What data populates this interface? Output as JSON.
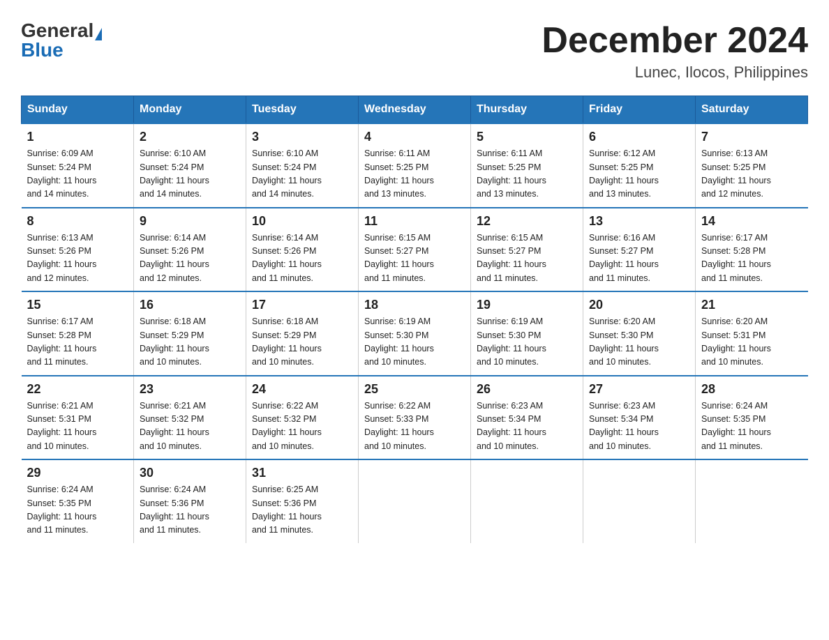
{
  "header": {
    "logo_general": "General",
    "logo_blue": "Blue",
    "month_title": "December 2024",
    "location": "Lunec, Ilocos, Philippines"
  },
  "days_of_week": [
    "Sunday",
    "Monday",
    "Tuesday",
    "Wednesday",
    "Thursday",
    "Friday",
    "Saturday"
  ],
  "weeks": [
    [
      {
        "day": "1",
        "sunrise": "6:09 AM",
        "sunset": "5:24 PM",
        "daylight": "11 hours and 14 minutes."
      },
      {
        "day": "2",
        "sunrise": "6:10 AM",
        "sunset": "5:24 PM",
        "daylight": "11 hours and 14 minutes."
      },
      {
        "day": "3",
        "sunrise": "6:10 AM",
        "sunset": "5:24 PM",
        "daylight": "11 hours and 14 minutes."
      },
      {
        "day": "4",
        "sunrise": "6:11 AM",
        "sunset": "5:25 PM",
        "daylight": "11 hours and 13 minutes."
      },
      {
        "day": "5",
        "sunrise": "6:11 AM",
        "sunset": "5:25 PM",
        "daylight": "11 hours and 13 minutes."
      },
      {
        "day": "6",
        "sunrise": "6:12 AM",
        "sunset": "5:25 PM",
        "daylight": "11 hours and 13 minutes."
      },
      {
        "day": "7",
        "sunrise": "6:13 AM",
        "sunset": "5:25 PM",
        "daylight": "11 hours and 12 minutes."
      }
    ],
    [
      {
        "day": "8",
        "sunrise": "6:13 AM",
        "sunset": "5:26 PM",
        "daylight": "11 hours and 12 minutes."
      },
      {
        "day": "9",
        "sunrise": "6:14 AM",
        "sunset": "5:26 PM",
        "daylight": "11 hours and 12 minutes."
      },
      {
        "day": "10",
        "sunrise": "6:14 AM",
        "sunset": "5:26 PM",
        "daylight": "11 hours and 11 minutes."
      },
      {
        "day": "11",
        "sunrise": "6:15 AM",
        "sunset": "5:27 PM",
        "daylight": "11 hours and 11 minutes."
      },
      {
        "day": "12",
        "sunrise": "6:15 AM",
        "sunset": "5:27 PM",
        "daylight": "11 hours and 11 minutes."
      },
      {
        "day": "13",
        "sunrise": "6:16 AM",
        "sunset": "5:27 PM",
        "daylight": "11 hours and 11 minutes."
      },
      {
        "day": "14",
        "sunrise": "6:17 AM",
        "sunset": "5:28 PM",
        "daylight": "11 hours and 11 minutes."
      }
    ],
    [
      {
        "day": "15",
        "sunrise": "6:17 AM",
        "sunset": "5:28 PM",
        "daylight": "11 hours and 11 minutes."
      },
      {
        "day": "16",
        "sunrise": "6:18 AM",
        "sunset": "5:29 PM",
        "daylight": "11 hours and 10 minutes."
      },
      {
        "day": "17",
        "sunrise": "6:18 AM",
        "sunset": "5:29 PM",
        "daylight": "11 hours and 10 minutes."
      },
      {
        "day": "18",
        "sunrise": "6:19 AM",
        "sunset": "5:30 PM",
        "daylight": "11 hours and 10 minutes."
      },
      {
        "day": "19",
        "sunrise": "6:19 AM",
        "sunset": "5:30 PM",
        "daylight": "11 hours and 10 minutes."
      },
      {
        "day": "20",
        "sunrise": "6:20 AM",
        "sunset": "5:30 PM",
        "daylight": "11 hours and 10 minutes."
      },
      {
        "day": "21",
        "sunrise": "6:20 AM",
        "sunset": "5:31 PM",
        "daylight": "11 hours and 10 minutes."
      }
    ],
    [
      {
        "day": "22",
        "sunrise": "6:21 AM",
        "sunset": "5:31 PM",
        "daylight": "11 hours and 10 minutes."
      },
      {
        "day": "23",
        "sunrise": "6:21 AM",
        "sunset": "5:32 PM",
        "daylight": "11 hours and 10 minutes."
      },
      {
        "day": "24",
        "sunrise": "6:22 AM",
        "sunset": "5:32 PM",
        "daylight": "11 hours and 10 minutes."
      },
      {
        "day": "25",
        "sunrise": "6:22 AM",
        "sunset": "5:33 PM",
        "daylight": "11 hours and 10 minutes."
      },
      {
        "day": "26",
        "sunrise": "6:23 AM",
        "sunset": "5:34 PM",
        "daylight": "11 hours and 10 minutes."
      },
      {
        "day": "27",
        "sunrise": "6:23 AM",
        "sunset": "5:34 PM",
        "daylight": "11 hours and 10 minutes."
      },
      {
        "day": "28",
        "sunrise": "6:24 AM",
        "sunset": "5:35 PM",
        "daylight": "11 hours and 11 minutes."
      }
    ],
    [
      {
        "day": "29",
        "sunrise": "6:24 AM",
        "sunset": "5:35 PM",
        "daylight": "11 hours and 11 minutes."
      },
      {
        "day": "30",
        "sunrise": "6:24 AM",
        "sunset": "5:36 PM",
        "daylight": "11 hours and 11 minutes."
      },
      {
        "day": "31",
        "sunrise": "6:25 AM",
        "sunset": "5:36 PM",
        "daylight": "11 hours and 11 minutes."
      },
      null,
      null,
      null,
      null
    ]
  ],
  "labels": {
    "sunrise": "Sunrise:",
    "sunset": "Sunset:",
    "daylight": "Daylight:"
  }
}
